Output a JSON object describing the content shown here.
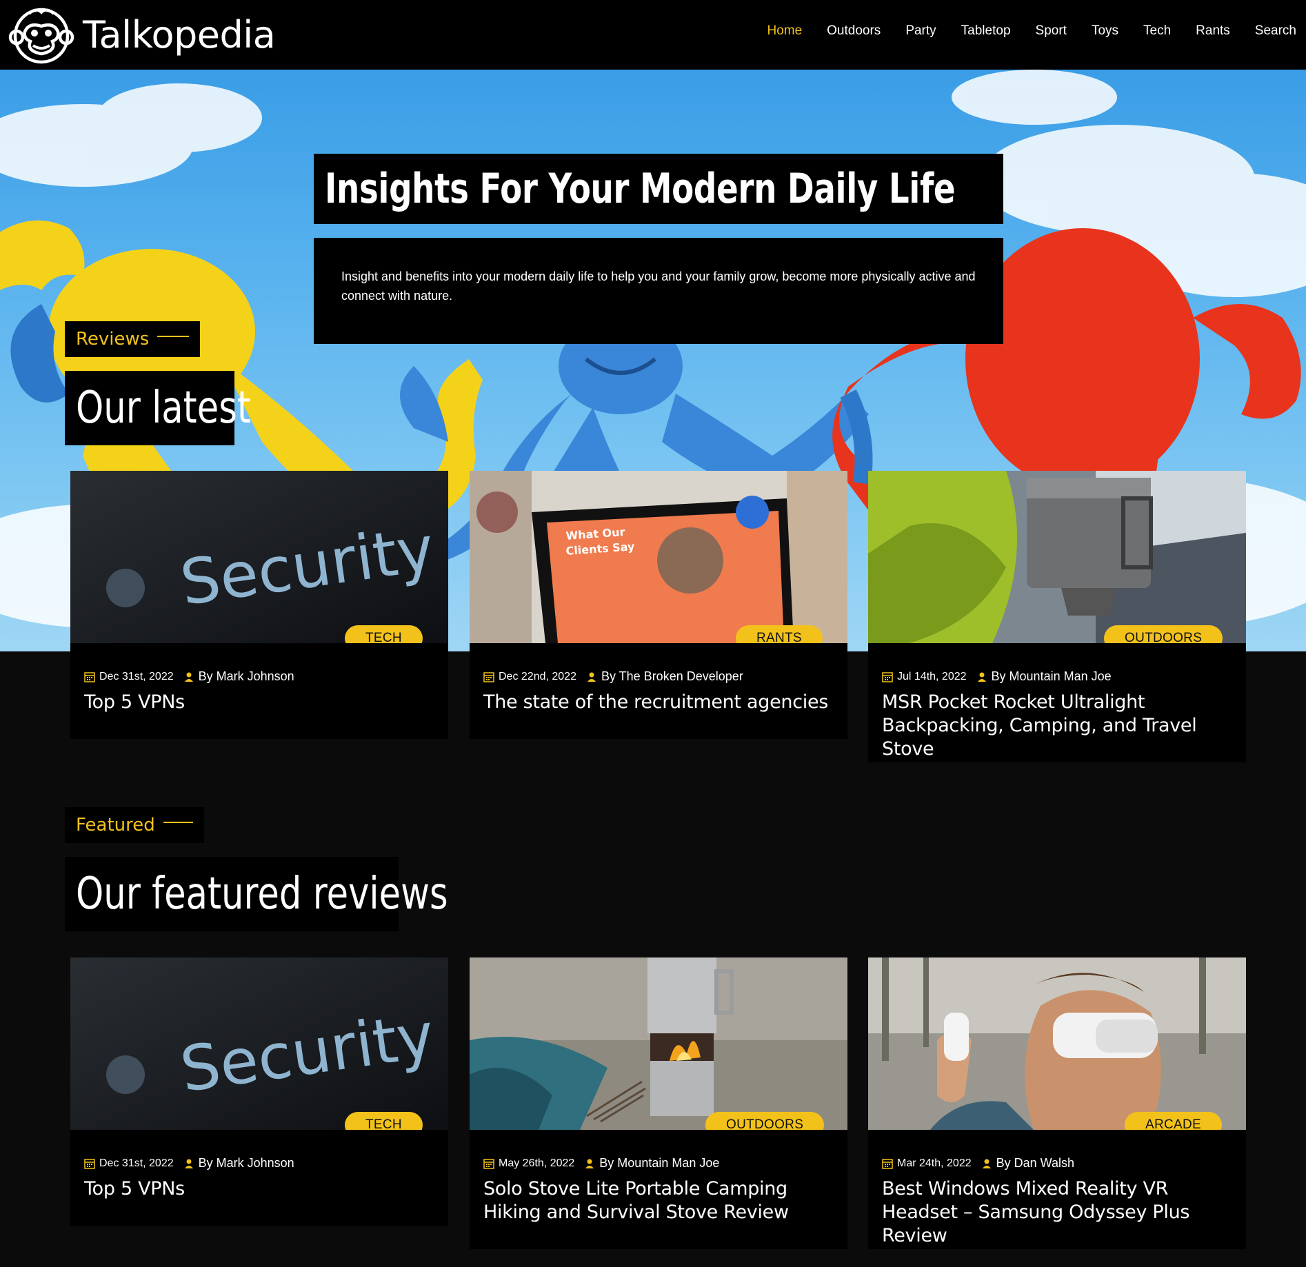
{
  "brand": {
    "name": "Talkopedia",
    "logo_icon": "monkey-face-icon"
  },
  "nav": {
    "items": [
      "Home",
      "Outdoors",
      "Party",
      "Tabletop",
      "Sport",
      "Toys",
      "Tech",
      "Rants",
      "Search"
    ],
    "active": "Home"
  },
  "hero": {
    "title": "Insights For Your Modern Daily Life",
    "description": "Insight and benefits into your modern daily life to help you and your family grow, become more physically active and connect with nature."
  },
  "latest": {
    "kicker": "Reviews",
    "title": "Our latest",
    "cards": [
      {
        "category": "TECH",
        "date": "Dec 31st, 2022",
        "author": "By Mark Johnson",
        "title": "Top 5 VPNs",
        "image": "security-screen"
      },
      {
        "category": "RANTS",
        "date": "Dec 22nd, 2022",
        "author": "By The Broken Developer",
        "title": "The state of the recruitment agencies",
        "image": "tablet-clients"
      },
      {
        "category": "OUTDOORS",
        "date": "Jul 14th, 2022",
        "author": "By Mountain Man Joe",
        "title": "MSR Pocket Rocket Ultralight Backpacking, Camping, and Travel Stove",
        "image": "camping-pot"
      }
    ]
  },
  "featured": {
    "kicker": "Featured",
    "title": "Our featured reviews",
    "cards": [
      {
        "category": "TECH",
        "date": "Dec 31st, 2022",
        "author": "By Mark Johnson",
        "title": "Top 5 VPNs",
        "image": "security-screen"
      },
      {
        "category": "OUTDOORS",
        "date": "May 26th, 2022",
        "author": "By Mountain Man Joe",
        "title": "Solo Stove Lite Portable Camping Hiking and Survival Stove Review",
        "image": "camp-stove-fire"
      },
      {
        "category": "ARCADE",
        "date": "Mar 24th, 2022",
        "author": "By Dan Walsh",
        "title": "Best Windows Mixed Reality VR Headset – Samsung Odyssey Plus Review",
        "image": "vr-headset"
      }
    ]
  },
  "colors": {
    "accent": "#f2c21b",
    "background": "#0b0b0b",
    "header": "#000000"
  }
}
